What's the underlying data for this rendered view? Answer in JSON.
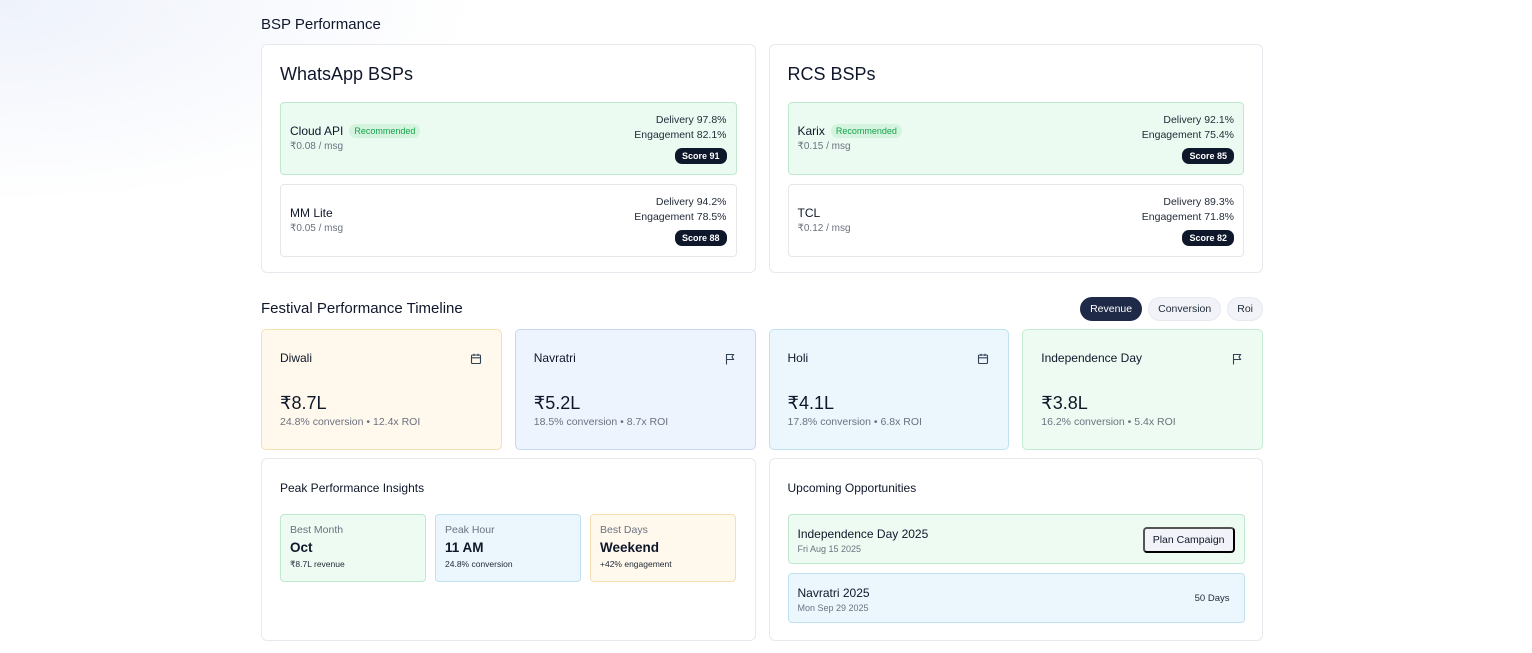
{
  "bsp_section": {
    "title": "BSP Performance",
    "panels": [
      {
        "title": "WhatsApp BSPs",
        "items": [
          {
            "name": "Cloud API",
            "badge": "Recommended",
            "price": "₹0.08 / msg",
            "delivery": "Delivery 97.8%",
            "engagement": "Engagement 82.1%",
            "score": "Score 91"
          },
          {
            "name": "MM Lite",
            "badge": "",
            "price": "₹0.05 / msg",
            "delivery": "Delivery 94.2%",
            "engagement": "Engagement 78.5%",
            "score": "Score 88"
          }
        ]
      },
      {
        "title": "RCS BSPs",
        "items": [
          {
            "name": "Karix",
            "badge": "Recommended",
            "price": "₹0.15 / msg",
            "delivery": "Delivery 92.1%",
            "engagement": "Engagement 75.4%",
            "score": "Score 85"
          },
          {
            "name": "TCL",
            "badge": "",
            "price": "₹0.12 / msg",
            "delivery": "Delivery 89.3%",
            "engagement": "Engagement 71.8%",
            "score": "Score 82"
          }
        ]
      }
    ]
  },
  "festival_section": {
    "title": "Festival Performance Timeline",
    "toggles": [
      {
        "label": "Revenue",
        "active": true
      },
      {
        "label": "Conversion",
        "active": false
      },
      {
        "label": "Roi",
        "active": false
      }
    ],
    "cards": [
      {
        "name": "Diwali",
        "icon": "calendar-icon",
        "value": "₹8.7L",
        "sub": "24.8% conversion • 12.4x ROI"
      },
      {
        "name": "Navratri",
        "icon": "flag-icon",
        "value": "₹5.2L",
        "sub": "18.5% conversion • 8.7x ROI"
      },
      {
        "name": "Holi",
        "icon": "calendar-icon",
        "value": "₹4.1L",
        "sub": "17.8% conversion • 6.8x ROI"
      },
      {
        "name": "Independence Day",
        "icon": "flag-icon",
        "value": "₹3.8L",
        "sub": "16.2% conversion • 5.4x ROI"
      }
    ]
  },
  "insights": {
    "title": "Peak Performance Insights",
    "items": [
      {
        "label": "Best Month",
        "value": "Oct",
        "detail": "₹8.7L revenue"
      },
      {
        "label": "Peak Hour",
        "value": "11 AM",
        "detail": "24.8% conversion"
      },
      {
        "label": "Best Days",
        "value": "Weekend",
        "detail": "+42% engagement"
      }
    ]
  },
  "opportunities": {
    "title": "Upcoming Opportunities",
    "items": [
      {
        "title": "Independence Day 2025",
        "date": "Fri Aug 15 2025",
        "action": "Plan Campaign"
      },
      {
        "title": "Navratri 2025",
        "date": "Mon Sep 29 2025",
        "days": "50 Days"
      }
    ]
  },
  "colors": {
    "primary_dark": "#1e2a47",
    "recommended_green": "#16a34a",
    "score_badge": "#0f172a"
  }
}
